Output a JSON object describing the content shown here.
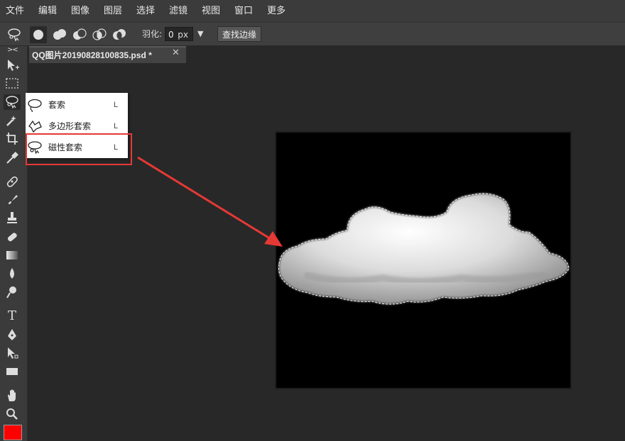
{
  "menu": [
    "文件",
    "编辑",
    "图像",
    "图层",
    "选择",
    "滤镜",
    "视图",
    "窗口",
    "更多"
  ],
  "options": {
    "feather_label": "羽化:",
    "feather_value": "0",
    "feather_unit": "px",
    "dropdown_glyph": "▼",
    "edge_button": "查找边缘"
  },
  "toolbar": {
    "collapse": "><",
    "type_tool": "T",
    "foreground_color": "#ff0000"
  },
  "document": {
    "tab_title": "QQ图片20190828100835.psd *",
    "close_glyph": "✕"
  },
  "flyout": [
    {
      "label": "套索",
      "key": "L",
      "icon": "lasso-icon"
    },
    {
      "label": "多边形套索",
      "key": "L",
      "icon": "polygonal-lasso-icon"
    },
    {
      "label": "磁性套索",
      "key": "L",
      "icon": "magnetic-lasso-icon"
    }
  ],
  "colors": {
    "annotation": "#e53935",
    "canvas_bg": "#000000",
    "app_bg": "#282828"
  }
}
